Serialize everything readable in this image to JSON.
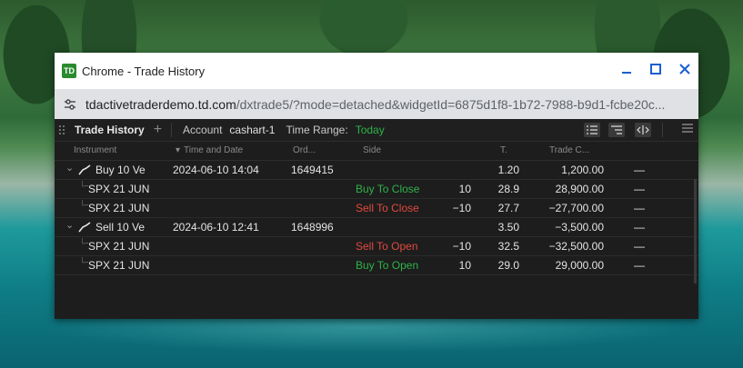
{
  "window": {
    "app_icon_text": "TD",
    "title": "Chrome - Trade History",
    "controls": [
      "minimize",
      "maximize",
      "close"
    ]
  },
  "url": {
    "host": "tdactivetraderdemo.td.com",
    "path": "/dxtrade5/?mode=detached&widgetId=6875d1f8-1b72-7988-b9d1-fcbe20c..."
  },
  "widget": {
    "title": "Trade History",
    "add_symbol": "+",
    "account_label": "Account",
    "account_value": "cashart-1",
    "time_range_label": "Time Range:",
    "time_range_value": "Today"
  },
  "columns": {
    "instrument": "Instrument",
    "time_and_date": "Time and Date",
    "order": "Ord...",
    "side": "Side",
    "t": "T.",
    "trade_cost": "Trade C..."
  },
  "rows": [
    {
      "type": "group",
      "instrument": "Buy  10  Ve",
      "time": "2024-06-10 14:04",
      "order": "1649415",
      "side": "",
      "qty": "",
      "price": "1.20",
      "trade_cost": "1,200.00",
      "extra": "—"
    },
    {
      "type": "leg",
      "instrument": "SPX 21 JUN ...",
      "time": "",
      "order": "",
      "side": "Buy To Close",
      "side_color": "green",
      "qty": "10",
      "price": "28.9",
      "trade_cost": "28,900.00",
      "extra": "—"
    },
    {
      "type": "leg",
      "instrument": "SPX 21 JUN ...",
      "time": "",
      "order": "",
      "side": "Sell To Close",
      "side_color": "red",
      "qty": "−10",
      "price": "27.7",
      "trade_cost": "−27,700.00",
      "extra": "—"
    },
    {
      "type": "group",
      "instrument": "Sell  10  Ve",
      "time": "2024-06-10 12:41",
      "order": "1648996",
      "side": "",
      "qty": "",
      "price": "3.50",
      "trade_cost": "−3,500.00",
      "extra": "—"
    },
    {
      "type": "leg",
      "instrument": "SPX 21 JUN ...",
      "time": "",
      "order": "",
      "side": "Sell To Open",
      "side_color": "red",
      "qty": "−10",
      "price": "32.5",
      "trade_cost": "−32,500.00",
      "extra": "—"
    },
    {
      "type": "leg",
      "instrument": "SPX 21 JUN ...",
      "time": "",
      "order": "",
      "side": "Buy To Open",
      "side_color": "green",
      "qty": "10",
      "price": "29.0",
      "trade_cost": "29,000.00",
      "extra": "—"
    }
  ],
  "icons": {
    "settings": "tune-icon",
    "expand": "chevron-down-icon",
    "strategy": "vertical-spread-icon",
    "tree": "tree-branch-icon"
  },
  "colors": {
    "buy": "#2fb24a",
    "sell": "#e2493e",
    "window_controls": "#1a5fd1"
  }
}
